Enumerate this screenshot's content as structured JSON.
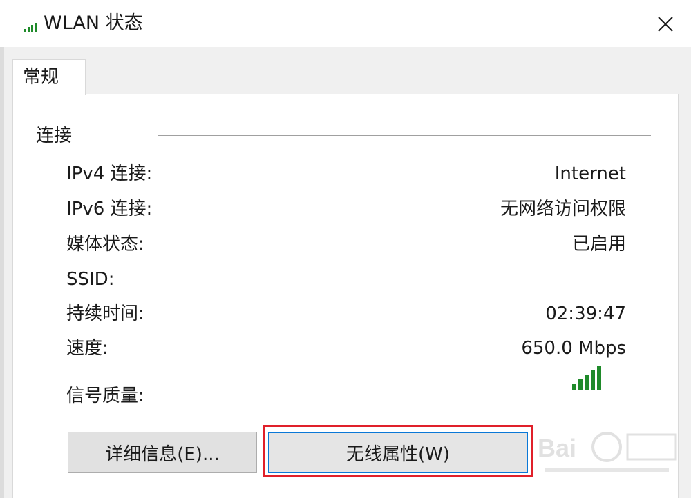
{
  "window": {
    "title": "WLAN 状态",
    "title_icon": "wifi-signal-icon",
    "close_icon": "close-icon"
  },
  "tabs": [
    {
      "label": "常规",
      "selected": true
    }
  ],
  "connection": {
    "section_title": "连接",
    "rows": [
      {
        "label": "IPv4 连接:",
        "value": "Internet"
      },
      {
        "label": "IPv6 连接:",
        "value": "无网络访问权限"
      },
      {
        "label": "媒体状态:",
        "value": "已启用"
      },
      {
        "label": "SSID:",
        "value": ""
      },
      {
        "label": "持续时间:",
        "value": "02:39:47"
      },
      {
        "label": "速度:",
        "value": "650.0 Mbps"
      }
    ],
    "signal_label": "信号质量:",
    "signal_icon": "signal-strength-icon",
    "signal_level": 5,
    "signal_max": 5
  },
  "buttons": {
    "details_label": "详细信息(E)...",
    "wireless_label": "无线属性(W)"
  },
  "colors": {
    "signal_green": "#1f8a2a",
    "highlight_red": "#e0202a",
    "focus_blue": "#0a78d7"
  }
}
